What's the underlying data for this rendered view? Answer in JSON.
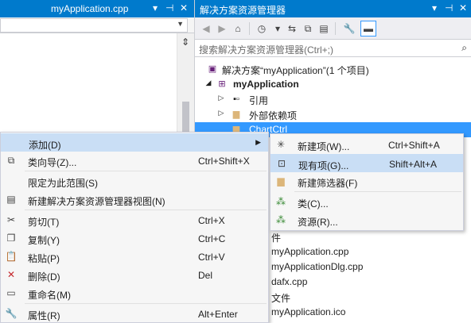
{
  "editor": {
    "tab_title": "myApplication.cpp",
    "tab_dropdown_icon": "▾",
    "tab_close_icon": "✕"
  },
  "solution_explorer": {
    "title": "解决方案资源管理器",
    "search_placeholder": "搜索解决方案资源管理器(Ctrl+;)",
    "tree": {
      "solution": "解决方案“myApplication”(1 个项目)",
      "project": "myApplication",
      "references": "引用",
      "external_deps": "外部依赖项",
      "chartctrl": "ChartCtrl",
      "partial_items": [
        "件",
        "myApplication.cpp",
        "myApplicationDlg.cpp",
        "dafx.cpp",
        "文件",
        "myApplication.ico"
      ]
    }
  },
  "context_menu": {
    "items": [
      {
        "label": "添加(D)",
        "shortcut": "",
        "icon": ""
      },
      {
        "label": "类向导(Z)...",
        "shortcut": "Ctrl+Shift+X",
        "icon": "class-wizard-icon"
      },
      {
        "label": "限定为此范围(S)",
        "shortcut": "",
        "icon": ""
      },
      {
        "label": "新建解决方案资源管理器视图(N)",
        "shortcut": "",
        "icon": "new-view-icon"
      },
      {
        "label": "剪切(T)",
        "shortcut": "Ctrl+X",
        "icon": "cut-icon"
      },
      {
        "label": "复制(Y)",
        "shortcut": "Ctrl+C",
        "icon": "copy-icon"
      },
      {
        "label": "粘贴(P)",
        "shortcut": "Ctrl+V",
        "icon": "paste-icon"
      },
      {
        "label": "删除(D)",
        "shortcut": "Del",
        "icon": "delete-icon"
      },
      {
        "label": "重命名(M)",
        "shortcut": "",
        "icon": "rename-icon"
      },
      {
        "label": "属性(R)",
        "shortcut": "Alt+Enter",
        "icon": "properties-icon"
      }
    ]
  },
  "submenu": {
    "items": [
      {
        "label": "新建项(W)...",
        "shortcut": "Ctrl+Shift+A",
        "icon": "new-item-icon"
      },
      {
        "label": "现有项(G)...",
        "shortcut": "Shift+Alt+A",
        "icon": "existing-item-icon"
      },
      {
        "label": "新建筛选器(F)",
        "shortcut": "",
        "icon": "new-filter-icon"
      },
      {
        "label": "类(C)...",
        "shortcut": "",
        "icon": "class-icon"
      },
      {
        "label": "资源(R)...",
        "shortcut": "",
        "icon": "resource-icon"
      }
    ]
  },
  "colors": {
    "accent": "#007acc",
    "selection": "#3399ff",
    "menu_highlight": "#c9def5"
  }
}
